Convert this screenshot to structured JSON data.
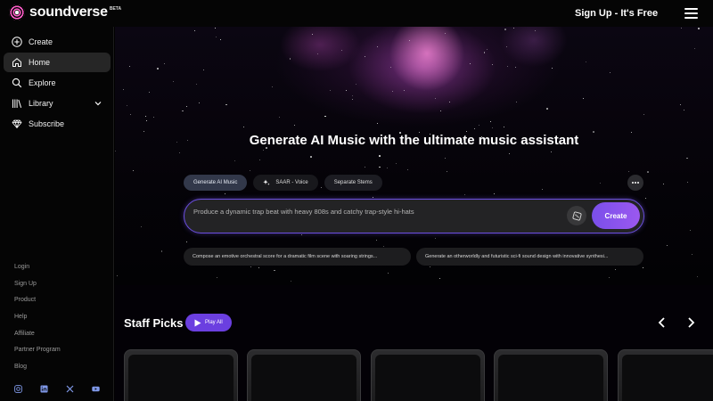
{
  "header": {
    "logo_text": "soundverse",
    "logo_badge": "BETA",
    "signup_label": "Sign Up - It's Free",
    "menu_icon": "hamburger-icon"
  },
  "sidebar": {
    "items": [
      {
        "label": "Create",
        "icon": "plus-circle-icon"
      },
      {
        "label": "Home",
        "icon": "home-icon",
        "active": true
      },
      {
        "label": "Explore",
        "icon": "search-icon"
      },
      {
        "label": "Library",
        "icon": "library-icon"
      },
      {
        "label": "Subscribe",
        "icon": "diamond-icon"
      }
    ],
    "footer_links": [
      "Login",
      "Sign Up",
      "Product",
      "Help",
      "Affiliate",
      "Partner Program",
      "Blog"
    ],
    "socials": [
      "instagram-icon",
      "linkedin-icon",
      "x-icon",
      "youtube-icon"
    ]
  },
  "hero": {
    "title": "Generate AI Music with the ultimate music assistant"
  },
  "tabs": [
    {
      "label": "Generate AI Music",
      "active": true
    },
    {
      "label": "SAAR - Voice",
      "icon": "sparkle-icon"
    },
    {
      "label": "Separate Stems"
    }
  ],
  "prompt": {
    "placeholder": "Produce a dynamic trap beat with heavy 808s and catchy trap-style hi-hats",
    "create_label": "Create"
  },
  "suggestions": [
    "Compose an emotive orchestral score for a dramatic film scene with soaring strings...",
    "Generate an otherworldly and futuristic sci-fi sound design with innovative synthesi..."
  ],
  "staff_picks": {
    "title": "Staff Picks",
    "play_all_label": "Play All"
  },
  "colors": {
    "accent": "#7a4fea",
    "sidebar_bg": "#050505",
    "active_tab": "#32384a"
  }
}
